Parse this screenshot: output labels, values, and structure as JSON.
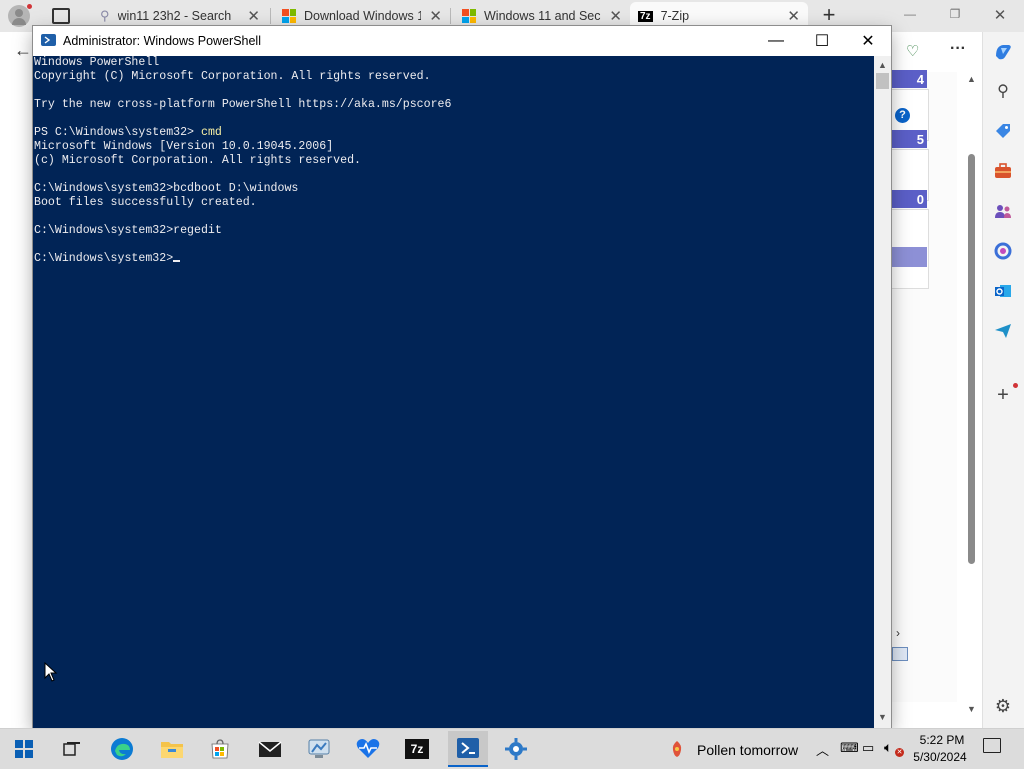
{
  "browser": {
    "tabs": [
      {
        "title": "win11 23h2 - Search",
        "close": "✕"
      },
      {
        "title": "Download Windows 1",
        "close": "✕"
      },
      {
        "title": "Windows 11 and Sec",
        "close": "✕"
      },
      {
        "title": "7-Zip",
        "close": "✕",
        "favicon_text": "7z"
      }
    ],
    "new_tab": "+",
    "window_controls": {
      "minimize": "—",
      "restore": "❐",
      "close": "✕"
    },
    "more_menu": "···",
    "behind_numbers": [
      "4",
      "5",
      "0"
    ],
    "help_icon": "?"
  },
  "ps_window": {
    "title": "Administrator: Windows PowerShell",
    "controls": {
      "minimize": "—",
      "maximize": "☐",
      "close": "✕"
    },
    "lines": [
      {
        "text": "Windows PowerShell"
      },
      {
        "text": "Copyright (C) Microsoft Corporation. All rights reserved."
      },
      {
        "text": ""
      },
      {
        "text": "Try the new cross-platform PowerShell https://aka.ms/pscore6"
      },
      {
        "text": ""
      },
      {
        "prompt": "PS C:\\Windows\\system32> ",
        "command": "cmd"
      },
      {
        "text": "Microsoft Windows [Version 10.0.19045.2006]"
      },
      {
        "text": "(c) Microsoft Corporation. All rights reserved."
      },
      {
        "text": ""
      },
      {
        "text": "C:\\Windows\\system32>bcdboot D:\\windows"
      },
      {
        "text": "Boot files successfully created."
      },
      {
        "text": ""
      },
      {
        "text": "C:\\Windows\\system32>regedit"
      },
      {
        "text": ""
      },
      {
        "text": "C:\\Windows\\system32>"
      }
    ],
    "colors": {
      "background": "#012456",
      "text": "#eeedf0",
      "command": "#f9f1a5"
    }
  },
  "taskbar": {
    "weather": "Pollen tomorrow",
    "time": "5:22 PM",
    "date": "5/30/2024",
    "app_7zip_label": "7z"
  }
}
